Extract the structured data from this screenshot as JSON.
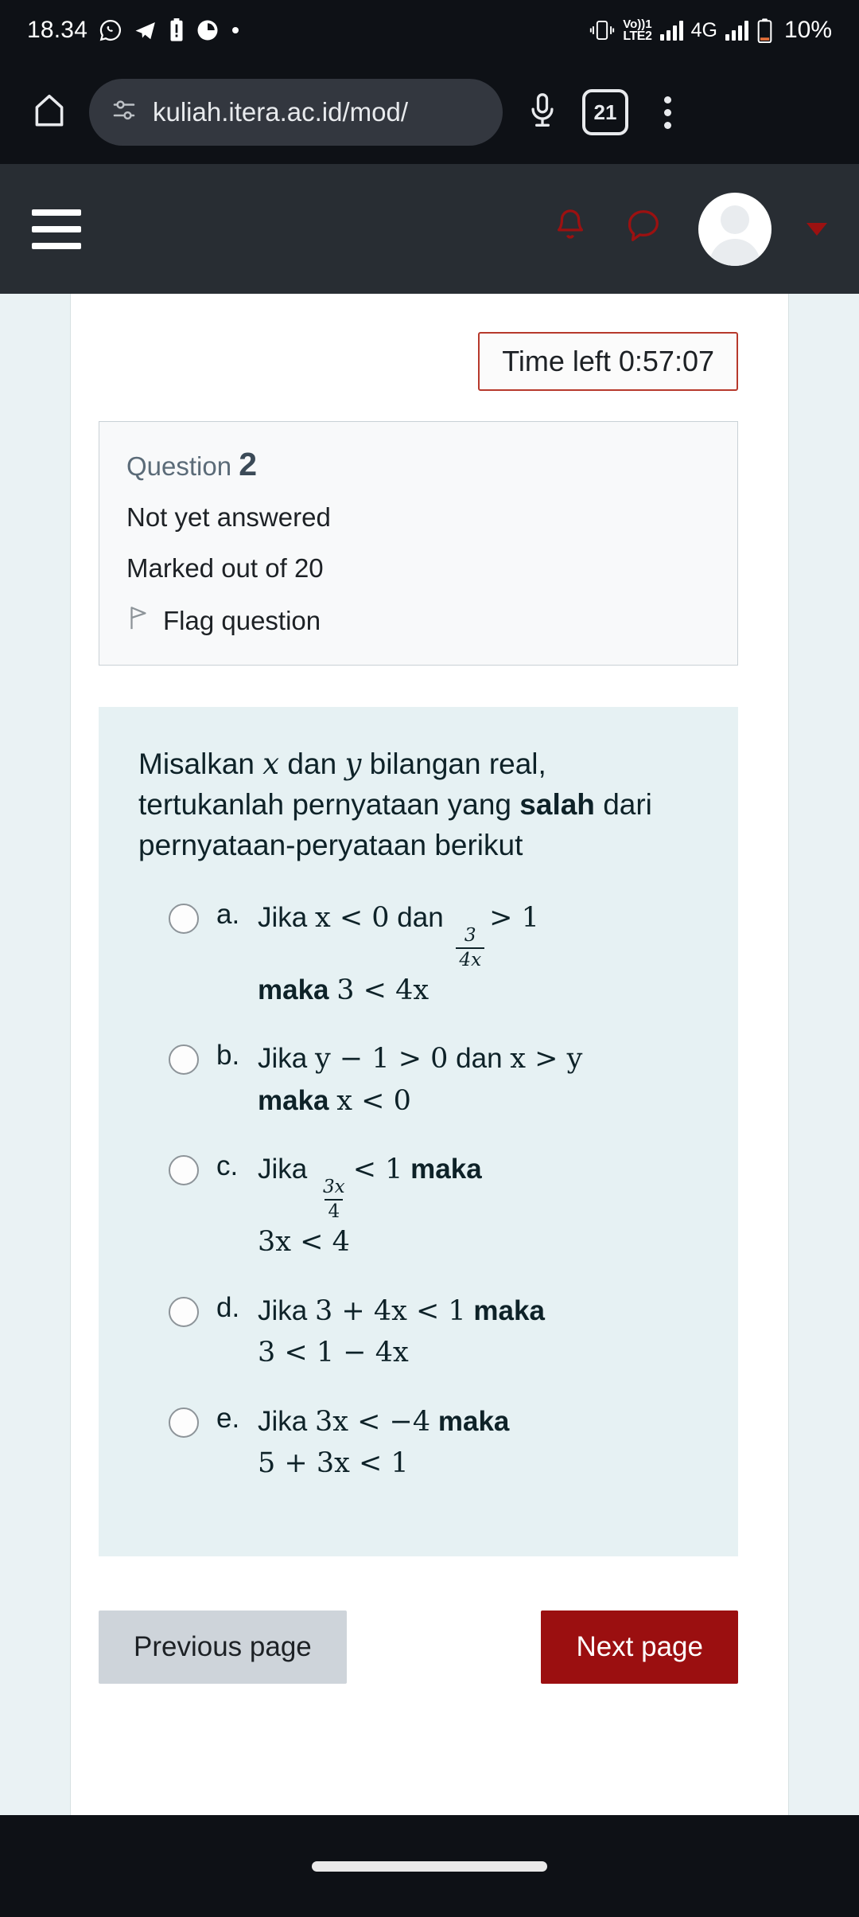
{
  "status_bar": {
    "clock": "18.34",
    "left_icons": [
      "whatsapp-icon",
      "telegram-icon",
      "battery-alert-icon",
      "app-icon",
      "dot-icon"
    ],
    "vibrate_icon": "vibrate-icon",
    "volte_line1": "VO)) 1",
    "volte_line2": "LTE 2",
    "network_label": "4G",
    "battery_percent": "10%"
  },
  "browser": {
    "home_icon": "home-icon",
    "site_settings_icon": "tune-icon",
    "url": "kuliah.itera.ac.id/mod/",
    "mic_icon": "microphone-icon",
    "tab_count": "21",
    "menu_icon": "overflow-menu-icon"
  },
  "moodle_nav": {
    "menu_icon": "hamburger-menu-icon",
    "notifications_icon": "bell-icon",
    "messages_icon": "message-bubble-icon",
    "avatar": "user-avatar",
    "caret": "chevron-down-icon"
  },
  "quiz": {
    "timer_label": "Time left 0:57:07",
    "question_label": "Question",
    "question_number": "2",
    "state": "Not yet answered",
    "marks": "Marked out of 20",
    "flag_icon": "flag-icon",
    "flag_label": "Flag question",
    "stem": {
      "part1": "Misalkan ",
      "var1": "x",
      "part2": " dan ",
      "var2": "y",
      "part3": " bilangan real, tertukanlah pernyataan yang ",
      "emphasis": "salah",
      "part4": " dari pernyataan-peryataan berikut"
    },
    "answers": [
      {
        "letter": "a.",
        "selected": false,
        "line1_pre": "Jika ",
        "line1_math_a": "x < 0",
        "line1_mid": " dan ",
        "frac_num": "3",
        "frac_den": "4x",
        "line1_post_math": "> 1",
        "line2_bold": "maka ",
        "line2_math": "3 < 4x"
      },
      {
        "letter": "b.",
        "selected": false,
        "line1_pre": "Jika ",
        "line1_math_a": "y − 1 > 0",
        "line1_mid": " dan ",
        "line1_math_b": "x > y",
        "line2_bold": "maka ",
        "line2_math": "x < 0"
      },
      {
        "letter": "c.",
        "selected": false,
        "line1_pre": "Jika ",
        "frac_num": "3x",
        "frac_den": "4",
        "line1_post_math": "< 1",
        "line1_bold_tail": " maka",
        "line2_math": "3x < 4"
      },
      {
        "letter": "d.",
        "selected": false,
        "line1_pre": "Jika ",
        "line1_math_a": "3 + 4x < 1",
        "line1_bold_tail": " maka",
        "line2_math": "3 < 1 − 4x"
      },
      {
        "letter": "e.",
        "selected": false,
        "line1_pre": "Jika ",
        "line1_math_a": "3x < −4",
        "line1_bold_tail": " maka",
        "line2_math": "5 + 3x < 1"
      }
    ],
    "prev_button": "Previous page",
    "next_button": "Next page"
  },
  "colors": {
    "accent_red": "#9b0f10",
    "timer_border": "#b7392c",
    "question_bg": "#e6f1f3",
    "nav_dark": "#282d33"
  }
}
